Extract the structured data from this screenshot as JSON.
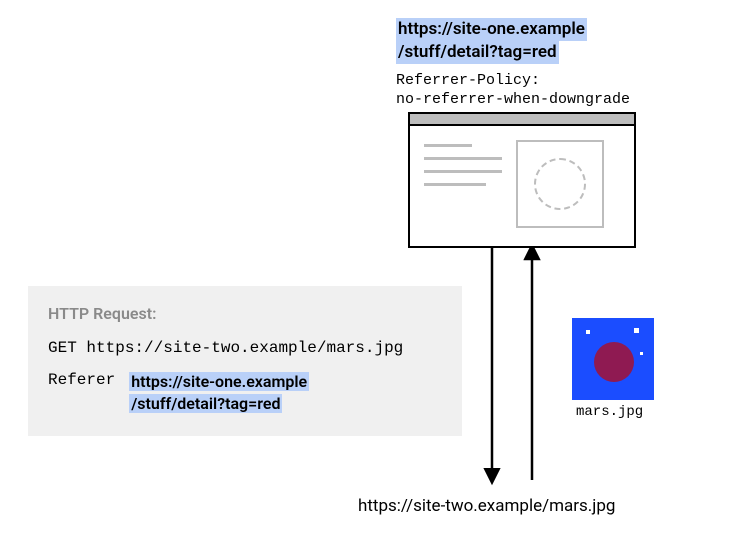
{
  "page": {
    "url_line1": "https://site-one.example",
    "url_line2": "/stuff/detail?tag=red",
    "referrer_policy_label": "Referrer-Policy:",
    "referrer_policy_value": "no-referrer-when-downgrade"
  },
  "browser": {
    "text_line": ""
  },
  "http_request": {
    "title": "HTTP Request:",
    "method": "GET",
    "request_url": "https://site-two.example/mars.jpg",
    "referer_label": "Referer",
    "referer_value_line1": "https://site-one.example",
    "referer_value_line2": "/stuff/detail?tag=red"
  },
  "image": {
    "filename": "mars.jpg",
    "served_from": "https://site-two.example/mars.jpg"
  }
}
